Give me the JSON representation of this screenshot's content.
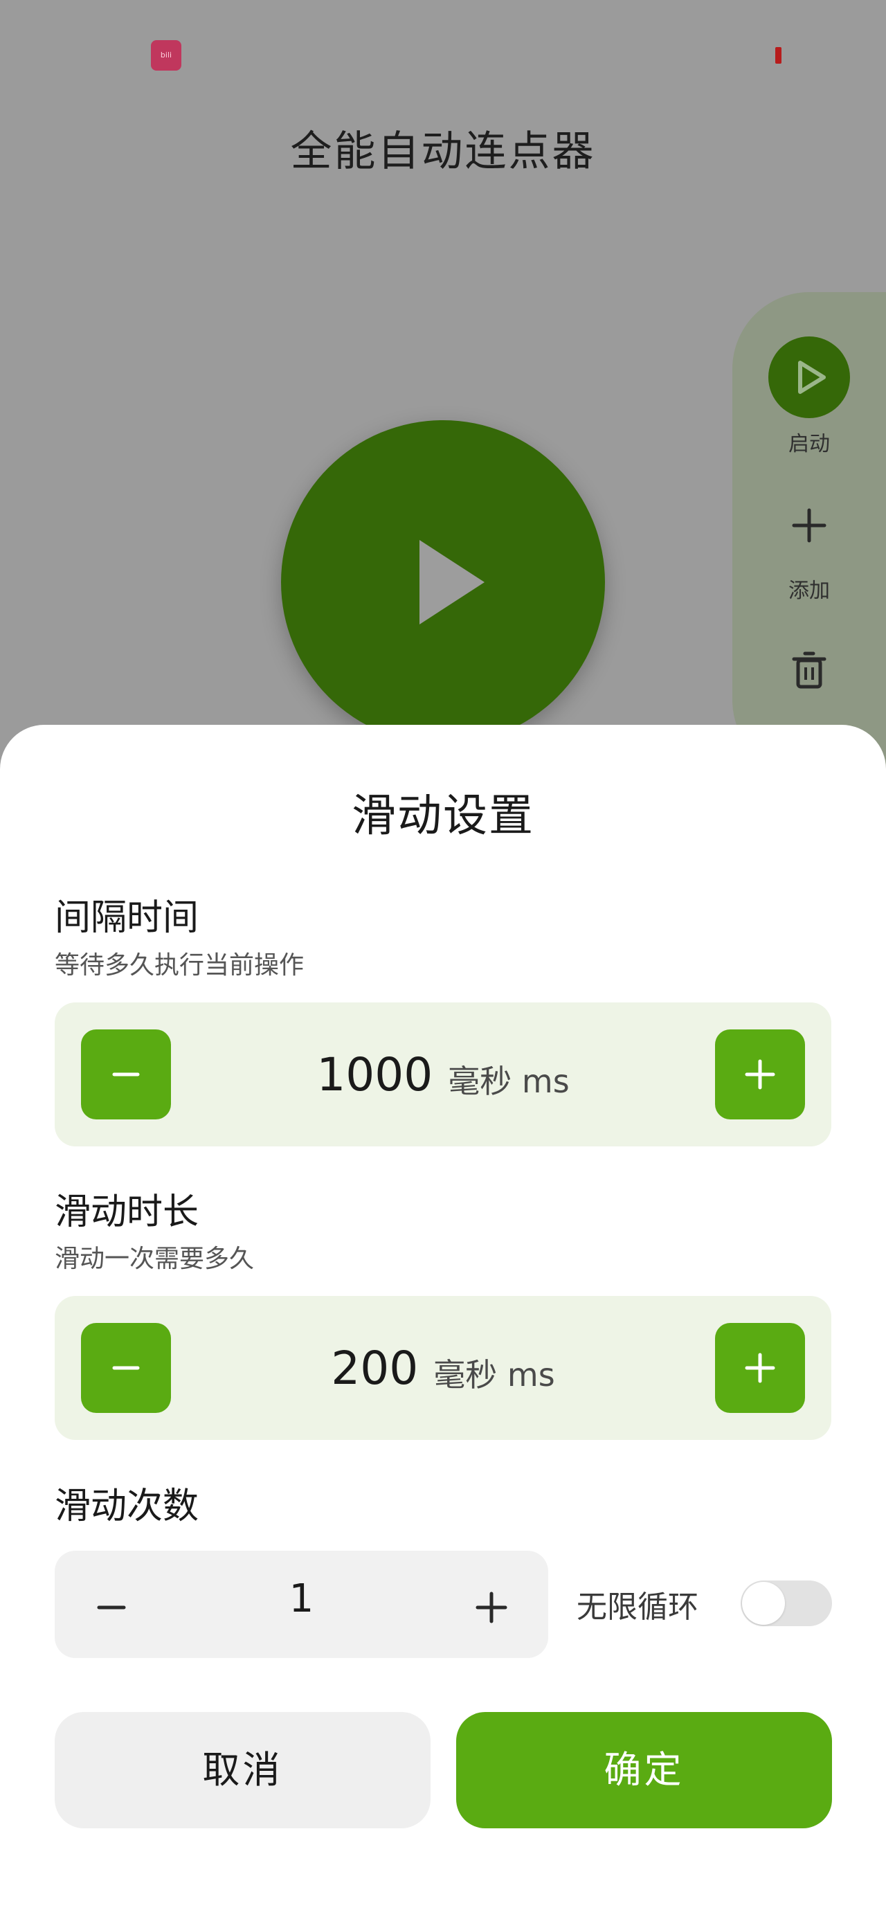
{
  "status_bar": {
    "app_icon_text": "bili"
  },
  "app": {
    "title": "全能自动连点器"
  },
  "side_panel": {
    "start_label": "启动",
    "add_label": "添加"
  },
  "dialog": {
    "title": "滑动设置",
    "interval": {
      "title": "间隔时间",
      "subtitle": "等待多久执行当前操作",
      "value": "1000",
      "unit": "毫秒 ms"
    },
    "duration": {
      "title": "滑动时长",
      "subtitle": "滑动一次需要多久",
      "value": "200",
      "unit": "毫秒 ms"
    },
    "count": {
      "title": "滑动次数",
      "value": "1",
      "infinite_label": "无限循环",
      "infinite_enabled": false
    },
    "cancel_label": "取消",
    "confirm_label": "确定"
  },
  "colors": {
    "accent": "#5aab12",
    "dark_green": "#356808",
    "overlay": "#9b9b9b",
    "stepper_bg": "#eef4e6"
  }
}
